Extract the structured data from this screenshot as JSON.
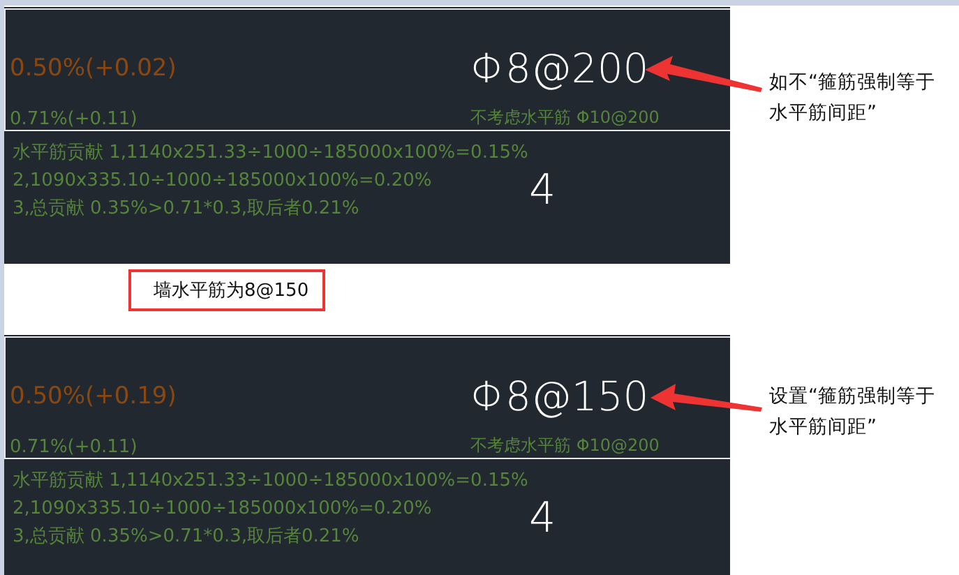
{
  "panels": [
    {
      "ratio": "0.50%(+0.02)",
      "bar": "Φ8@200",
      "min_ratio": "0.71%(+0.11)",
      "note": "不考虑水平筋 Φ10@200",
      "calc": [
        "水平筋贡献 1,1140x251.33÷1000÷185000x100%=0.15%",
        "2,1090x335.10÷1000÷185000x100%=0.20%",
        "3,总贡献 0.35%>0.71*0.3,取后者0.21%"
      ],
      "count": "4",
      "callout": "如不“箍筋强制等于水平筋间距”"
    },
    {
      "ratio": "0.50%(+0.19)",
      "bar": "Φ8@150",
      "min_ratio": "0.71%(+0.11)",
      "note": "不考虑水平筋 Φ10@200",
      "calc": [
        "水平筋贡献 1,1140x251.33÷1000÷185000x100%=0.15%",
        "2,1090x335.10÷1000÷185000x100%=0.20%",
        "3,总贡献 0.35%>0.71*0.3,取后者0.21%"
      ],
      "count": "4",
      "callout": "设置“箍筋强制等于水平筋间距”"
    }
  ],
  "note_box": "墙水平筋为8@150"
}
